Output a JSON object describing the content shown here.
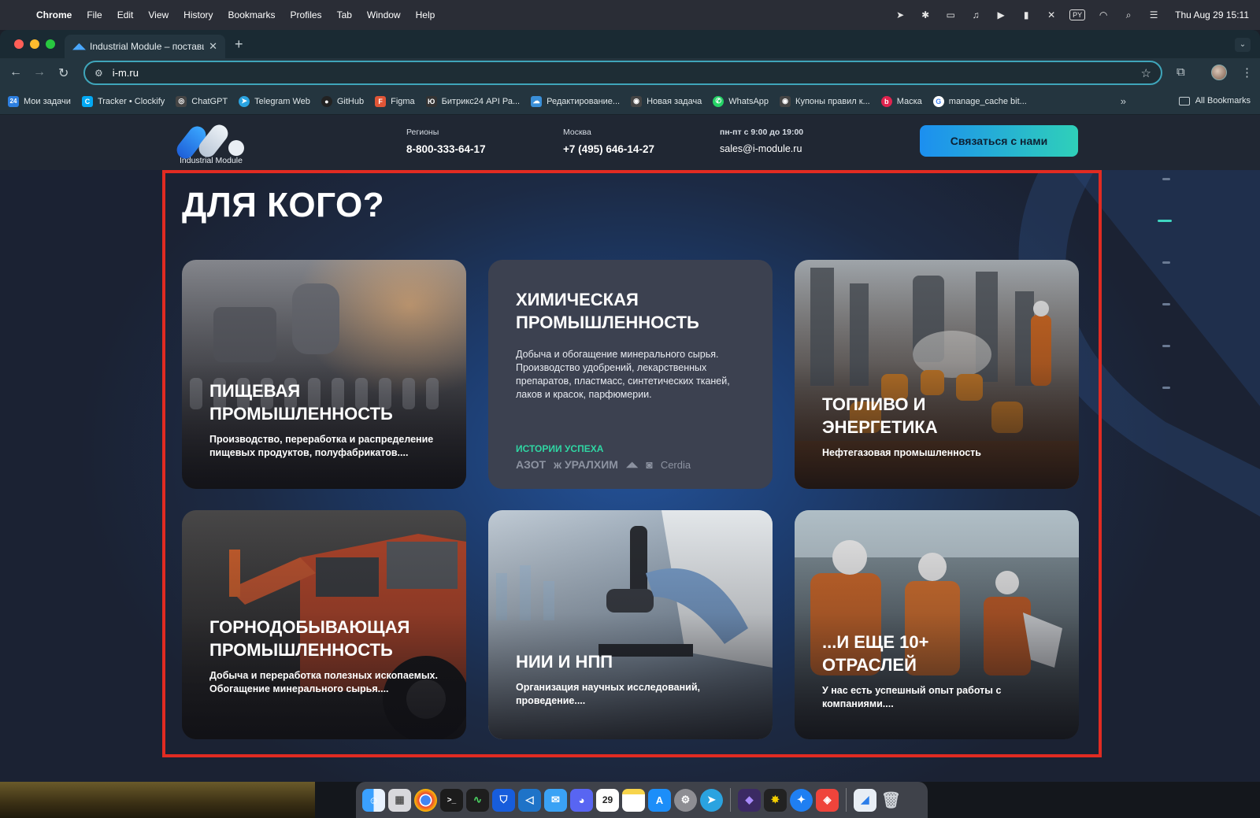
{
  "menubar": {
    "app": "Chrome",
    "items": [
      "File",
      "Edit",
      "View",
      "History",
      "Bookmarks",
      "Profiles",
      "Tab",
      "Window",
      "Help"
    ],
    "status_icons": [
      "navigation-icon",
      "bluetooth-icon",
      "screen-icon",
      "audio-icon",
      "play-icon",
      "battery-icon",
      "mute-icon",
      "keyboard-layout-icon",
      "wifi-icon",
      "search-icon",
      "control-center-icon"
    ],
    "keyboard_layout": "PY",
    "clock": "Thu Aug 29  15:11"
  },
  "browser": {
    "tab_title": "Industrial Module – поставщ",
    "url": "i-m.ru",
    "bookmarks": [
      {
        "label": "Мои задачи",
        "icon": "24",
        "color": "#2d7fe0"
      },
      {
        "label": "Tracker • Clockify",
        "icon": "C",
        "color": "#03a9f4"
      },
      {
        "label": "ChatGPT",
        "icon": "◎",
        "color": "#444"
      },
      {
        "label": "Telegram Web",
        "icon": "➤",
        "color": "#2aa3e0"
      },
      {
        "label": "GitHub",
        "icon": "●",
        "color": "#222"
      },
      {
        "label": "Figma",
        "icon": "F",
        "color": "#e05536"
      },
      {
        "label": "Битрикс24 API Ра...",
        "icon": "Ю",
        "color": "#333"
      },
      {
        "label": "Редактирование...",
        "icon": "☁",
        "color": "#3a8fd8"
      },
      {
        "label": "Новая задача",
        "icon": "◉",
        "color": "#444"
      },
      {
        "label": "WhatsApp",
        "icon": "✆",
        "color": "#25d366"
      },
      {
        "label": "Купоны правил к...",
        "icon": "◉",
        "color": "#444"
      },
      {
        "label": "Маска",
        "icon": "b",
        "color": "#e0234e"
      },
      {
        "label": "manage_cache bit...",
        "icon": "G",
        "color": "#4285f4"
      }
    ],
    "all_bookmarks": "All Bookmarks"
  },
  "site": {
    "logo_text": "Industrial Module",
    "contacts": [
      {
        "label": "Регионы",
        "value": "8-800-333-64-17"
      },
      {
        "label": "Москва",
        "value": "+7 (495) 646-14-27"
      },
      {
        "label": "пн-пт с 9:00 до 19:00",
        "value": "sales@i-module.ru"
      }
    ],
    "cta": "Связаться с нами"
  },
  "section": {
    "title": "ДЛЯ КОГО?",
    "cards": [
      {
        "title": "ПИЩЕВАЯ ПРОМЫШЛЕННОСТЬ",
        "desc": "Производство, переработка и распределение пищевых продуктов, полуфабрикатов...."
      },
      {
        "title": "ХИМИЧЕСКАЯ ПРОМЫШЛЕННОСТЬ",
        "desc": "Добыча и обогащение минерального сырья. Производство удобрений, лекарственных препаратов, пластмасс, синтетических тканей, лаков и красок, парфюмерии.",
        "success_label": "ИСТОРИИ УСПЕХА",
        "logos": [
          "АЗОТ",
          "ж УРАЛХИМ",
          "Cerdia"
        ]
      },
      {
        "title": "ТОПЛИВО И ЭНЕРГЕТИКА",
        "desc": "Нефтегазовая промышленность"
      },
      {
        "title": "ГОРНОДОБЫВАЮЩАЯ ПРОМЫШЛЕННОСТЬ",
        "desc": "Добыча и переработка полезных ископаемых. Обогащение минерального сырья...."
      },
      {
        "title": "НИИ И НПП",
        "desc": "Организация научных исследований, проведение...."
      },
      {
        "title": "...И ЕЩЕ 10+ ОТРАСЛЕЙ",
        "desc": "У нас есть успешный опыт работы с компаниями...."
      }
    ]
  },
  "dock": {
    "apps": [
      "finder-icon",
      "launchpad-icon",
      "chrome-icon",
      "terminal-icon",
      "activity-monitor-icon",
      "bitwarden-icon",
      "vscode-icon",
      "mail-icon",
      "discord-icon",
      "calendar-icon",
      "notes-icon",
      "app-store-icon",
      "system-settings-icon",
      "telegram-icon",
      "obsidian-icon",
      "spark-icon",
      "safari-icon",
      "anydesk-icon",
      "preview-icon",
      "trash-icon"
    ],
    "calendar_day": "29"
  }
}
